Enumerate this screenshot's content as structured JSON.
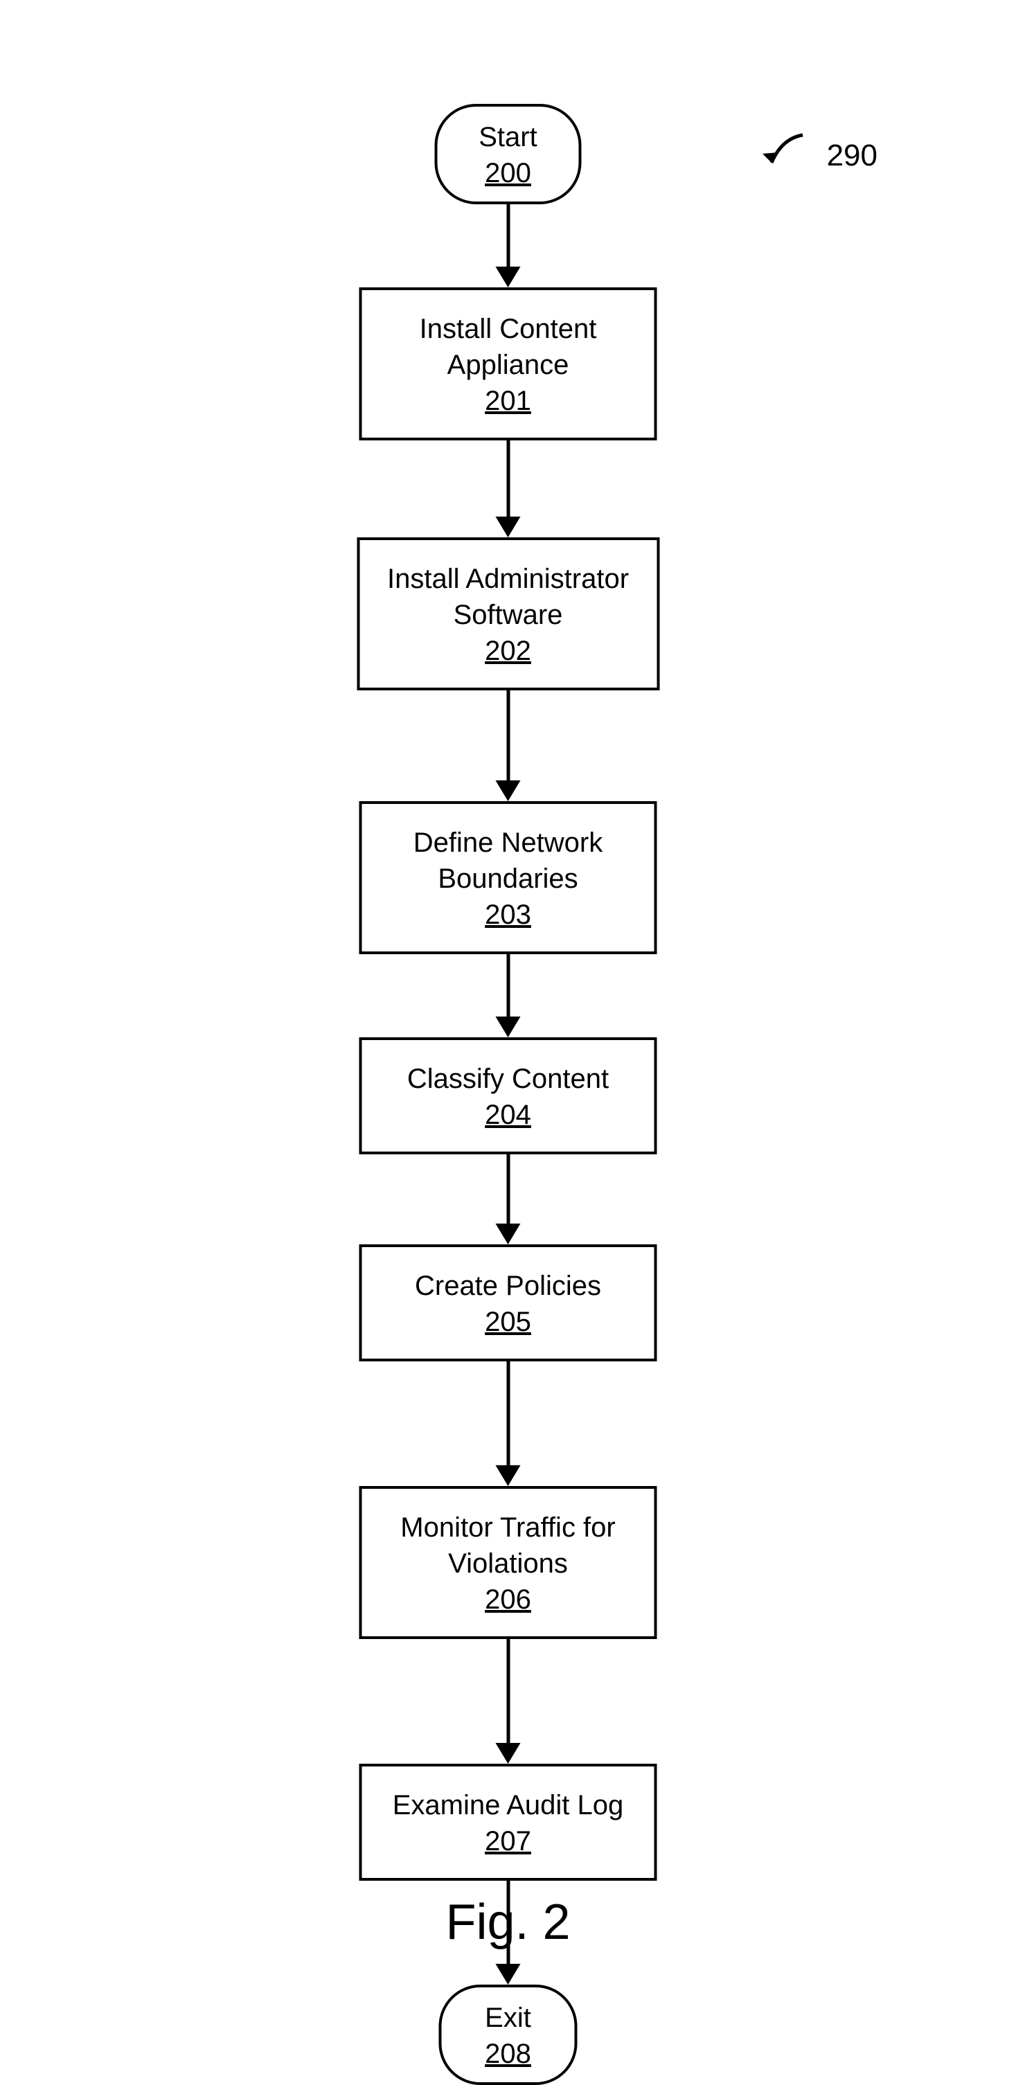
{
  "diagram_ref": "290",
  "figure_caption": "Fig. 2",
  "nodes": {
    "start": {
      "title": "Start",
      "ref": "200"
    },
    "step1": {
      "title": "Install Content\nAppliance",
      "ref": "201"
    },
    "step2": {
      "title": "Install Administrator\nSoftware",
      "ref": "202"
    },
    "step3": {
      "title": "Define Network\nBoundaries",
      "ref": "203"
    },
    "step4": {
      "title": "Classify Content",
      "ref": "204"
    },
    "step5": {
      "title": "Create Policies",
      "ref": "205"
    },
    "step6": {
      "title": "Monitor Traffic for\nViolations",
      "ref": "206"
    },
    "step7": {
      "title": "Examine Audit Log",
      "ref": "207"
    },
    "exit": {
      "title": "Exit",
      "ref": "208"
    }
  }
}
